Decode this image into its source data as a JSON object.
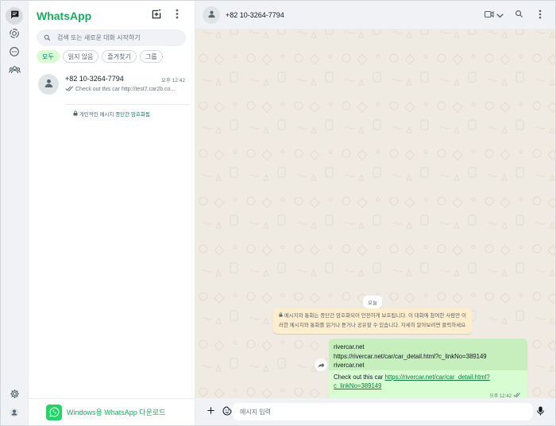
{
  "app": {
    "title": "WhatsApp"
  },
  "colors": {
    "brand": "#1daa61",
    "chat_bg": "#efeae2",
    "outgoing_bubble": "#d9fdd3",
    "system_bubble": "#ffeecd",
    "link": "#1a7f4b"
  },
  "rail": {
    "top_items": [
      {
        "icon": "chats-icon",
        "active": true
      },
      {
        "icon": "status-icon"
      },
      {
        "icon": "channels-icon"
      },
      {
        "icon": "communities-icon"
      }
    ],
    "bottom_items": [
      {
        "icon": "settings-icon"
      },
      {
        "icon": "profile-icon"
      }
    ]
  },
  "list": {
    "search_placeholder": "검색 또는 새로운 대화 시작하기",
    "filters": [
      "모두",
      "읽지 않음",
      "즐겨찾기",
      "그룹"
    ],
    "chats": [
      {
        "name": "+82 10-3264-7794",
        "time": "오후 12:42",
        "preview": "Check out this car http://test7.car2b.co..."
      }
    ],
    "encryption_note_prefix": "개인적인 메시지 ",
    "encryption_note_link": "종단간 암호화됨",
    "download_label": "Windows용 WhatsApp 다운로드"
  },
  "conversation": {
    "contact_name": "+82 10-3264-7794",
    "day_label": "오늘",
    "system_message": "메시지와 통화는 종단간 암호화되어 안전하게 보호됩니다. 이 대화에 참여한 사람만 이러한 메시지와 통화를 읽거나 듣거나 공유할 수 있습니다. 자세히 알아보려면 클릭하세요",
    "message": {
      "preview_title": "rivercar.net",
      "preview_url": "https://rivercar.net/car/car_detail.html?c_linkNo=389149",
      "preview_domain": "rivercar.net",
      "text_prefix": "Check out this car ",
      "link": "https://rivercar.net/car/car_detail.html?c_linkNo=389149",
      "time": "오후 12:42"
    },
    "composer_placeholder": "메시지 입력"
  }
}
